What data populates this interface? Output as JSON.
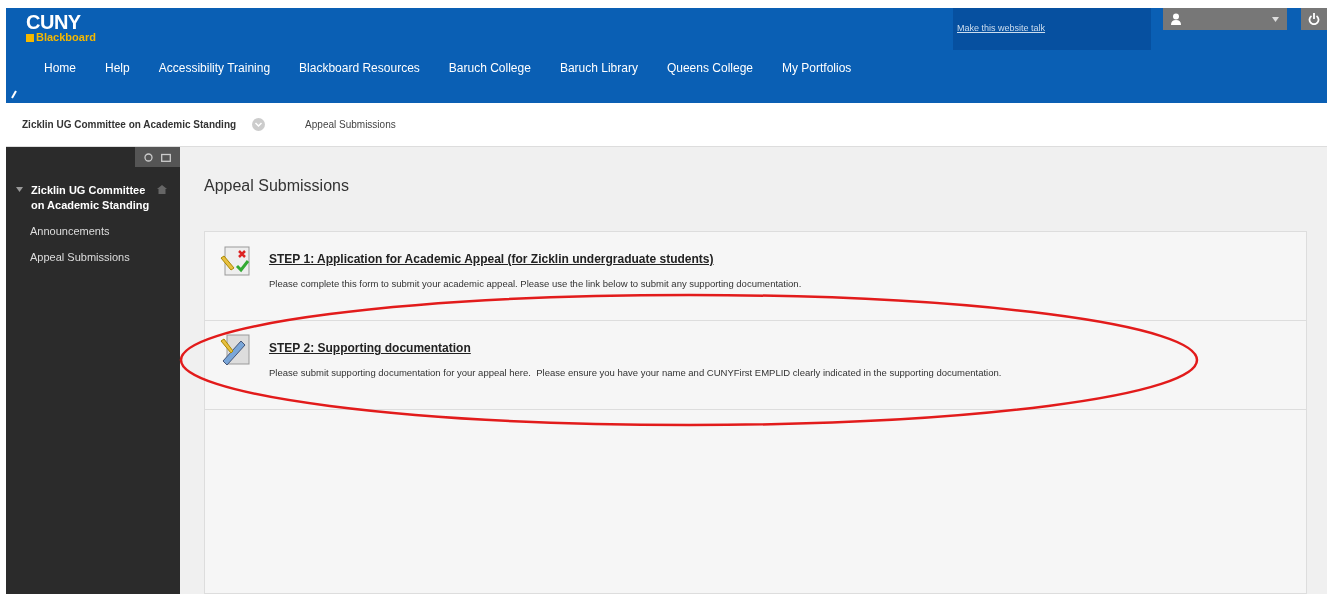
{
  "header": {
    "logo": {
      "title": "CUNY",
      "subtitle": "Blackboard"
    },
    "talk_link": "Make this website talk",
    "nav": [
      "Home",
      "Help",
      "Accessibility Training",
      "Blackboard Resources",
      "Baruch College",
      "Baruch Library",
      "Queens College",
      "My Portfolios"
    ]
  },
  "breadcrumb": [
    "Zicklin UG Committee on Academic Standing",
    "Appeal Submissions"
  ],
  "sidebar": {
    "course_title": "Zicklin UG Committee on Academic Standing",
    "expanded": true,
    "items": [
      "Announcements",
      "Appeal Submissions"
    ]
  },
  "page_title": "Appeal Submissions",
  "content_items": [
    {
      "kind": "form",
      "title": "STEP 1: Application for Academic Appeal (for Zicklin undergraduate students)",
      "description": "Please complete this form to submit your academic appeal. Please use the link below to submit any supporting documentation."
    },
    {
      "kind": "assignment",
      "title": "STEP 2: Supporting documentation",
      "description": "Please submit supporting documentation for your appeal here.  Please ensure you have your name and CUNYFirst EMPLID clearly indicated in the supporting documentation."
    }
  ]
}
